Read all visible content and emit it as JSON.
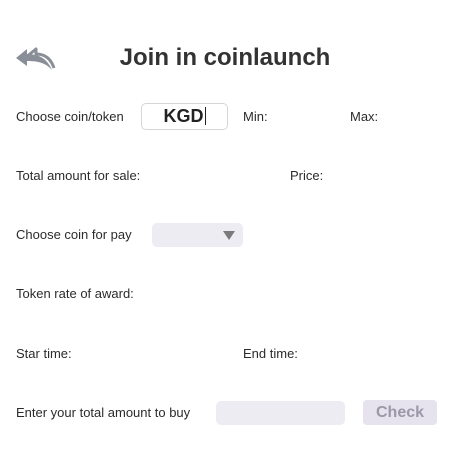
{
  "header": {
    "back_icon": "double-back-arrow-icon",
    "title": "Join in coinlaunch"
  },
  "form": {
    "choose_coin_label": "Choose coin/token",
    "coin_value": "KGD",
    "min_label": "Min:",
    "max_label": "Max:",
    "total_amount_label": "Total amount for sale:",
    "price_label": "Price:",
    "choose_pay_label": "Choose coin for pay",
    "pay_select_value": "",
    "token_rate_label": "Token rate of award:",
    "start_time_label": "Star time:",
    "end_time_label": "End time:",
    "amount_to_buy_label": "Enter your total amount to buy",
    "amount_to_buy_value": "",
    "check_button": "Check"
  },
  "colors": {
    "field_bg": "#eeecf3",
    "button_bg": "#e6e2ee",
    "button_text": "#9c98a8",
    "icon": "#8a8e96"
  }
}
